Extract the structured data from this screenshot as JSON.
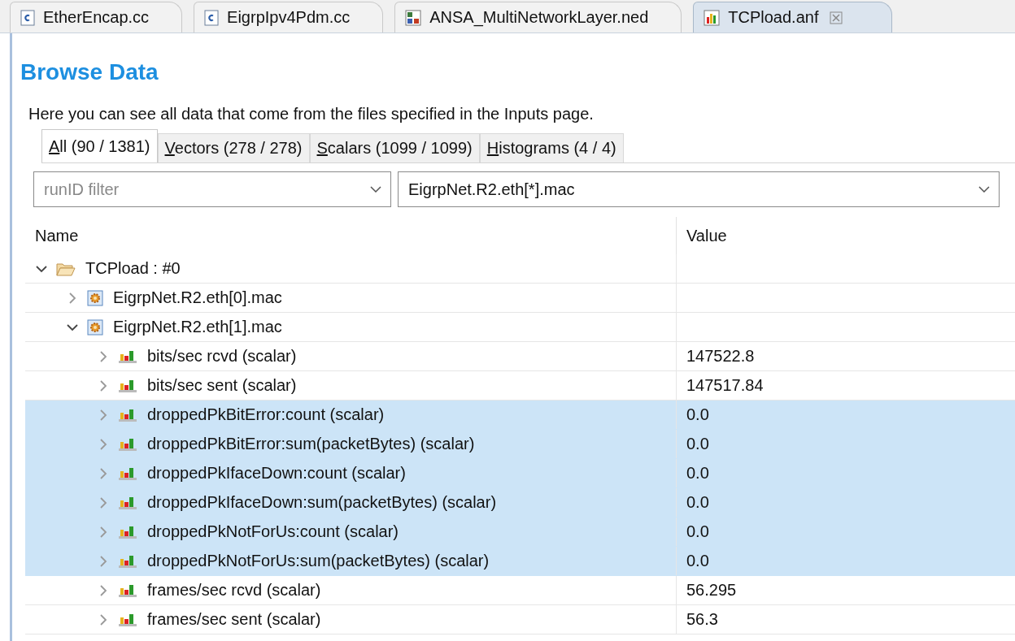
{
  "editor_tabs": [
    {
      "label": "EtherEncap.cc",
      "kind": "cc",
      "selected": false
    },
    {
      "label": "EigrpIpv4Pdm.cc",
      "kind": "cc",
      "selected": false
    },
    {
      "label": "ANSA_MultiNetworkLayer.ned",
      "kind": "ned",
      "selected": false
    },
    {
      "label": "TCPload.anf",
      "kind": "anf",
      "selected": true
    }
  ],
  "page": {
    "title": "Browse Data",
    "description": "Here you can see all data that come from the files specified in the Inputs page."
  },
  "data_tabs": [
    {
      "label": "All (90 / 1381)",
      "selected": true,
      "mnemonic": true
    },
    {
      "label": "Vectors (278 / 278)",
      "selected": false,
      "mnemonic": true
    },
    {
      "label": "Scalars (1099 / 1099)",
      "selected": false,
      "mnemonic": true
    },
    {
      "label": "Histograms (4 / 4)",
      "selected": false,
      "mnemonic": true
    }
  ],
  "filters": [
    {
      "placeholder": "runID filter"
    },
    {
      "value": "EigrpNet.R2.eth[*].mac"
    }
  ],
  "table": {
    "columns": [
      "Name",
      "Value"
    ],
    "rows": [
      {
        "name": "TCPload : #0",
        "kind": "folder",
        "expanded": true,
        "selected": false,
        "children": [
          {
            "name": "EigrpNet.R2.eth[0].mac",
            "kind": "module",
            "expanded": false,
            "selected": false
          },
          {
            "name": "EigrpNet.R2.eth[1].mac",
            "kind": "module",
            "expanded": true,
            "selected": false,
            "children": [
              {
                "name": "bits/sec rcvd (scalar)",
                "value": "147522.8",
                "kind": "scalar",
                "expanded": false,
                "selected": false
              },
              {
                "name": "bits/sec sent (scalar)",
                "value": "147517.84",
                "kind": "scalar",
                "expanded": false,
                "selected": false
              },
              {
                "name": "droppedPkBitError:count (scalar)",
                "value": "0.0",
                "kind": "scalar",
                "expanded": false,
                "selected": true
              },
              {
                "name": "droppedPkBitError:sum(packetBytes) (scalar)",
                "value": "0.0",
                "kind": "scalar",
                "expanded": false,
                "selected": true
              },
              {
                "name": "droppedPkIfaceDown:count (scalar)",
                "value": "0.0",
                "kind": "scalar",
                "expanded": false,
                "selected": true
              },
              {
                "name": "droppedPkIfaceDown:sum(packetBytes) (scalar)",
                "value": "0.0",
                "kind": "scalar",
                "expanded": false,
                "selected": true
              },
              {
                "name": "droppedPkNotForUs:count (scalar)",
                "value": "0.0",
                "kind": "scalar",
                "expanded": false,
                "selected": true
              },
              {
                "name": "droppedPkNotForUs:sum(packetBytes) (scalar)",
                "value": "0.0",
                "kind": "scalar",
                "expanded": false,
                "selected": true
              },
              {
                "name": "frames/sec rcvd (scalar)",
                "value": "56.295",
                "kind": "scalar",
                "expanded": false,
                "selected": false
              },
              {
                "name": "frames/sec sent (scalar)",
                "value": "56.3",
                "kind": "scalar",
                "expanded": false,
                "selected": false
              }
            ]
          }
        ]
      }
    ]
  }
}
